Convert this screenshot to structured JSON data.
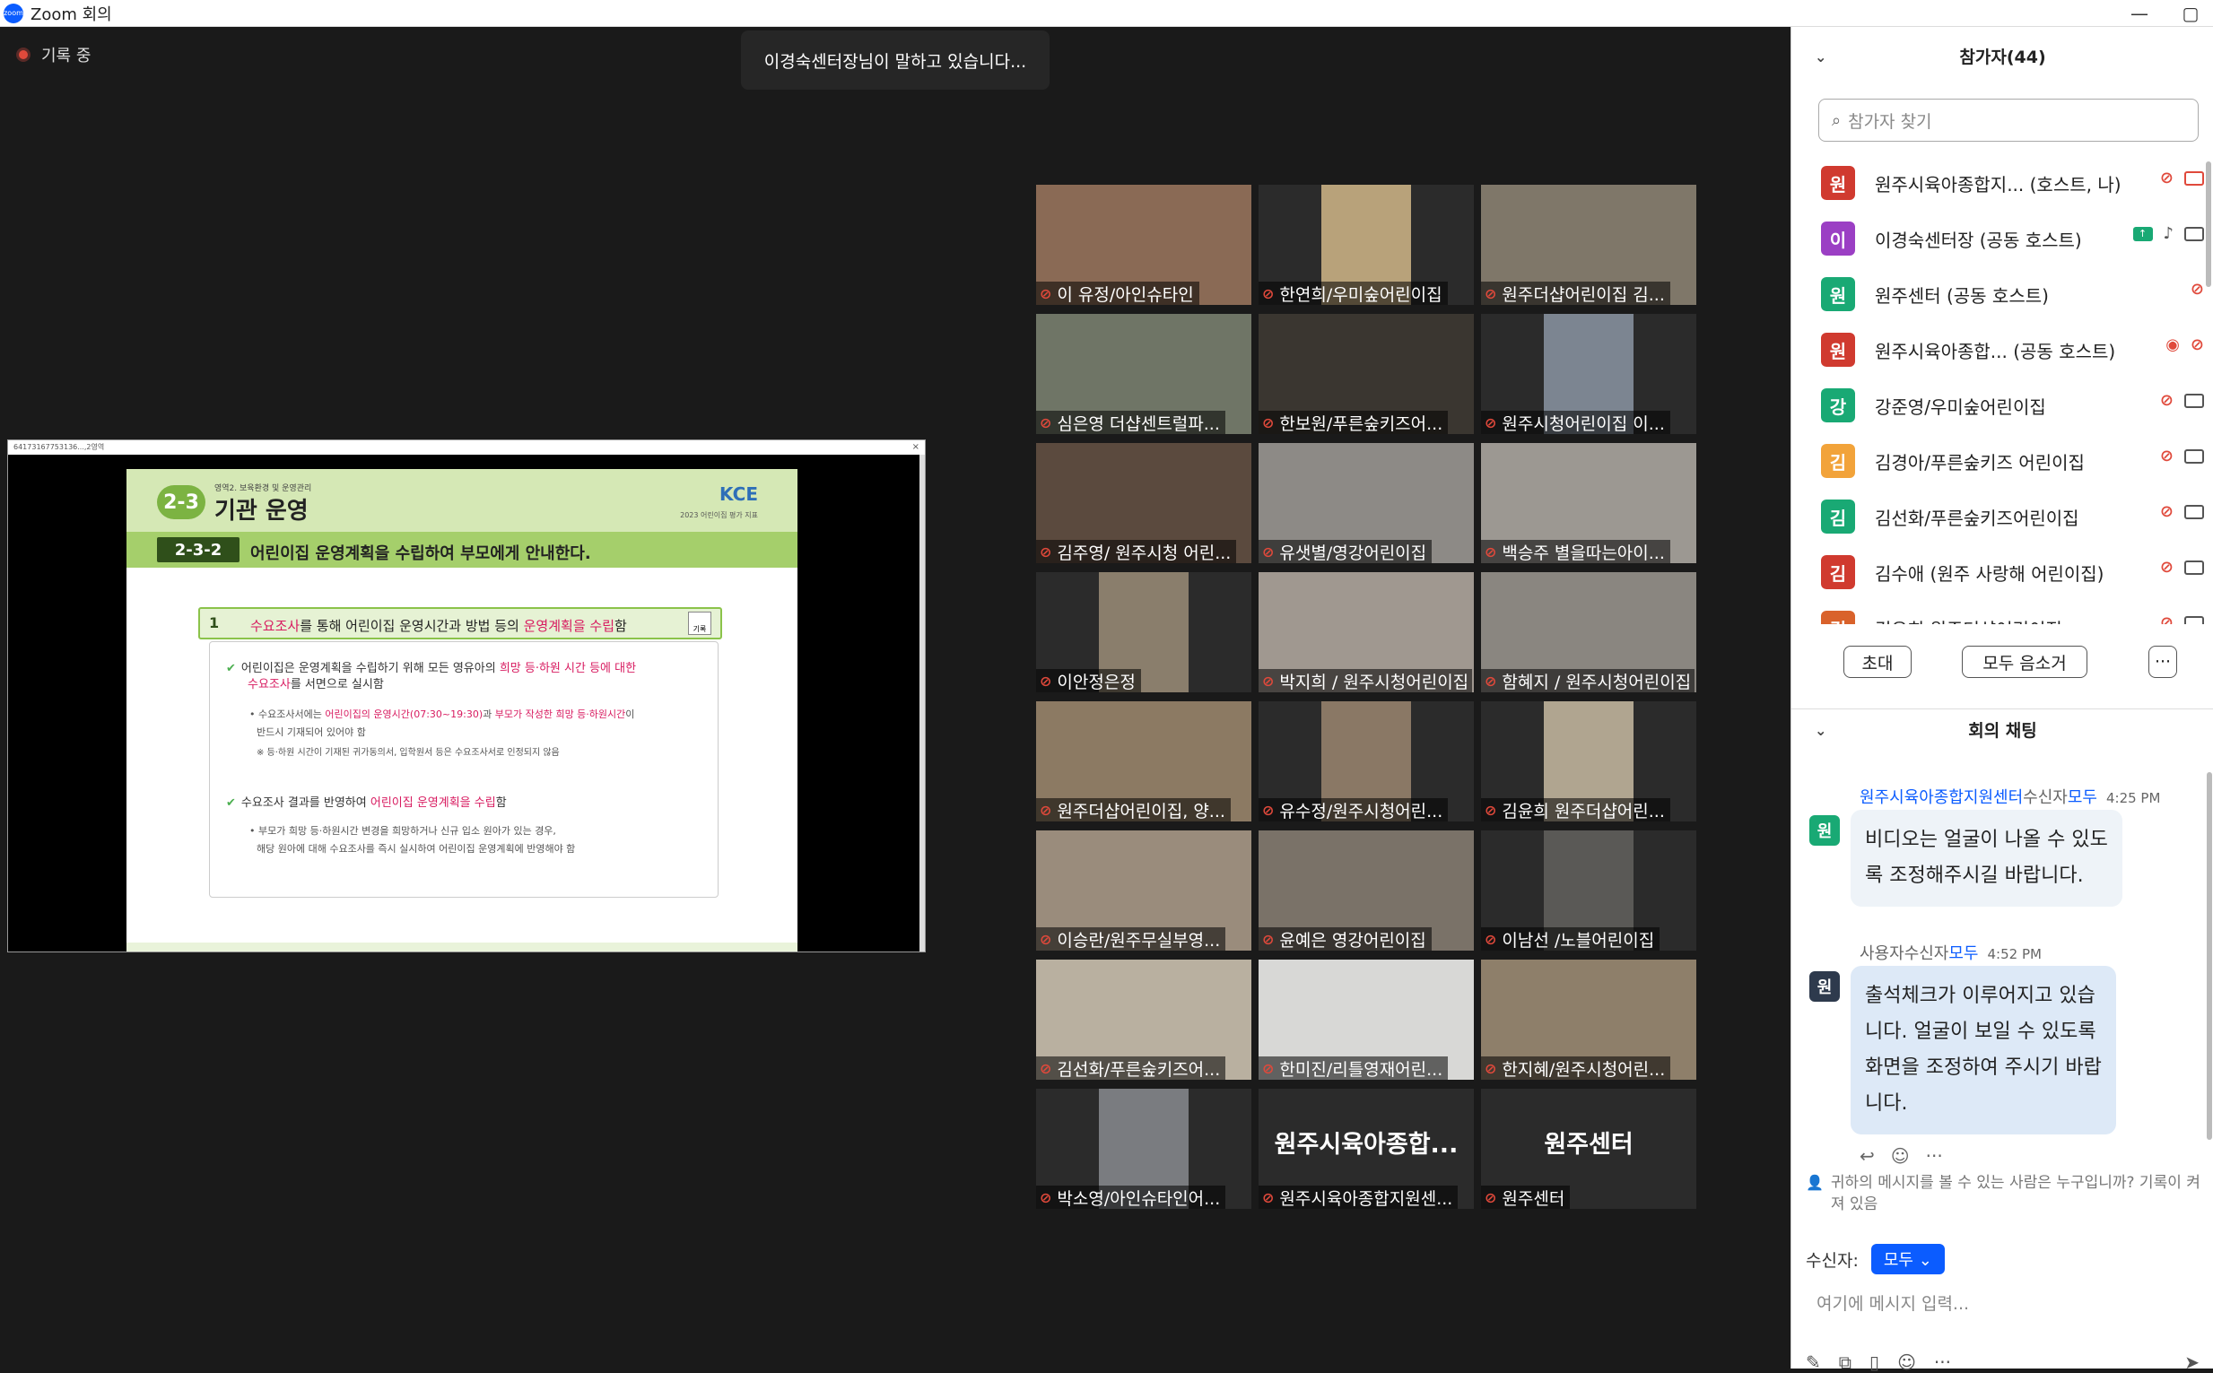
{
  "window": {
    "title": "Zoom 회의",
    "logo": "zoom"
  },
  "main": {
    "recording": "기록 중",
    "speaking": "이경숙센터장님이 말하고 있습니다...",
    "share": {
      "tab": "6417316775313​6...,2영역",
      "slide": {
        "subheading": "영역2. 보육환경 및 운영관리",
        "badge": "2-3",
        "title": "기관 운영",
        "logo": "KCE",
        "logo_sub": "2023 어린이집 평가 지표",
        "num": "2-3-2",
        "indicator": "어린이집 운영계획을 수립하여 부모에게 안내한다.",
        "item_num": "1",
        "item_a": "수요조사",
        "item_b": "를 통해 어린이집 운영시간과 방법 등의 ",
        "item_c": "운영계획을 수립",
        "item_d": "함",
        "pen_label": "기록",
        "p1a": "어린이집은 운영계획을 수립하기 위해 모든 영유아의 ",
        "p1b": "희망 등·하원 시간 등에 대한",
        "p1c": "수요조사",
        "p1d": "를 서면으로 실시함",
        "s1a": "• 수요조사서에는 ",
        "s1b": "어린이집의 운영시간(07:30~19:30)",
        "s1c": "과 ",
        "s1d": "부모가 작성한 희망 등·하원시간",
        "s1e": "이",
        "s1f": "반드시 기재되어 있어야 함",
        "s1g": "※ 등·하원 시간이 기재된 귀가동의서, 입학원서 등은 수요조사서로 인정되지 않음",
        "p2a": "수요조사 결과를 반영하여 ",
        "p2b": "어린이집 운영계획을 수립",
        "p2c": "함",
        "s2a": "• 부모가 희망 등·하원시간 변경을 희망하거나 신규 입소 원아가 있는 경우,",
        "s2b": "해당 원아에 대해 수요조사를 즉시 실시하여 어린이집 운영계획에 반영해야 함"
      }
    },
    "tiles": [
      {
        "name": "이 유정/아인슈타인",
        "video": "#8a6a55"
      },
      {
        "name": "한연희/우미숲어린이집",
        "video": "#b8a27a"
      },
      {
        "name": "원주더샵어린이집 김...",
        "video": "#7f7769"
      },
      {
        "name": "심은영 더샵센트럴파...",
        "video": "#6f7566"
      },
      {
        "name": "한보원/푸른숲키즈어...",
        "video": "#3a3630"
      },
      {
        "name": "원주시청어린이집 이...",
        "video": "#7c8591"
      },
      {
        "name": "김주영/ 원주시청 어린...",
        "video": "#5b4a3e"
      },
      {
        "name": "유샛별/영강어린이집",
        "video": "#8d8a86"
      },
      {
        "name": "백승주 별을따는아이...",
        "video": "#9c9892"
      },
      {
        "name": "이안정은정",
        "video": "#8a7e6c"
      },
      {
        "name": "박지희 / 원주시청어린이집",
        "video": "#a09890"
      },
      {
        "name": "함혜지 / 원주시청어린이집",
        "video": "#8a8680"
      },
      {
        "name": "원주더샵어린이집, 양...",
        "video": "#8c7a63"
      },
      {
        "name": "유수정/원주시청어린...",
        "video": "#8a7865"
      },
      {
        "name": "김윤희 원주더샵어린...",
        "video": "#b0a590"
      },
      {
        "name": "이승란/원주무실부영...",
        "video": "#9a8c7c"
      },
      {
        "name": "윤예은 영강어린이집",
        "video": "#7a7268"
      },
      {
        "name": "이남선 /노블어린이집",
        "video": "#5a5956"
      },
      {
        "name": "김선화/푸른숲키즈어...",
        "video": "#b9b0a0"
      },
      {
        "name": "한미진/리틀영재어린...",
        "video": "#d8d8d6"
      },
      {
        "name": "한지혜/원주시청어린...",
        "video": "#8e7f6a"
      },
      {
        "name": "박소영/아인슈타인어...",
        "video": "#7a7c80"
      },
      {
        "name": "원주시육아종합지원센...",
        "big": "원주시육아종합..."
      },
      {
        "name": "원주센터",
        "big": "원주센터"
      }
    ]
  },
  "participants": {
    "header": "참가자(44)",
    "search_placeholder": "참가자 찾기",
    "list": [
      {
        "initial": "원",
        "name": "원주시육아종합지...  (호스트, 나)",
        "color": "#d03a2f",
        "state": "host"
      },
      {
        "initial": "이",
        "name": "이경숙센터장 (공동 호스트)",
        "color": "#9b3fc4",
        "state": "speaking"
      },
      {
        "initial": "원",
        "name": "원주센터 (공동 호스트)",
        "color": "#19a974",
        "state": "muted-only"
      },
      {
        "initial": "원",
        "name": "원주시육아종합...  (공동 호스트)",
        "color": "#d03a2f",
        "state": "rec"
      },
      {
        "initial": "강",
        "name": "강준영/우미숲어린이집",
        "color": "#19a974",
        "state": "muted"
      },
      {
        "initial": "김",
        "name": "김경아/푸른숲키즈 어린이집",
        "color": "#f2a33a",
        "state": "muted"
      },
      {
        "initial": "김",
        "name": "김선화/푸른숲키즈어린이집",
        "color": "#19a974",
        "state": "muted"
      },
      {
        "initial": "김",
        "name": "김수애 (원주 사랑해 어린이집)",
        "color": "#d03a2f",
        "state": "muted"
      },
      {
        "initial": "김",
        "name": "김유희 원주더샵어린이집",
        "color": "#d9622b",
        "state": "muted"
      }
    ],
    "invite": "초대",
    "mute_all": "모두 음소거",
    "more": "···"
  },
  "chat": {
    "header": "회의 채팅",
    "messages": [
      {
        "sender": "원주시육아종합지원센터",
        "to_label": "수신자",
        "to": "모두",
        "time": "4:25 PM",
        "initial": "원",
        "color": "#19a974",
        "lines": [
          "비디오는 얼굴이 나올 수 있도",
          "록 조정해주시길 바랍니다."
        ]
      },
      {
        "sender": "사용자",
        "to_label": "수신자",
        "to": "모두",
        "time": "4:52 PM",
        "initial": "원",
        "color": "#2e3a4d",
        "lines": [
          "출석체크가 이루어지고 있습",
          "니다. 얼굴이 보일 수 있도록",
          "화면을 조정하여 주시기 바랍",
          "니다."
        ]
      }
    ],
    "notice": "귀하의 메시지를 볼 수 있는 사람은 누구입니까? 기록이 켜져 있음",
    "recipient_label": "수신자:",
    "recipient": "모두",
    "input_placeholder": "여기에 메시지 입력..."
  }
}
